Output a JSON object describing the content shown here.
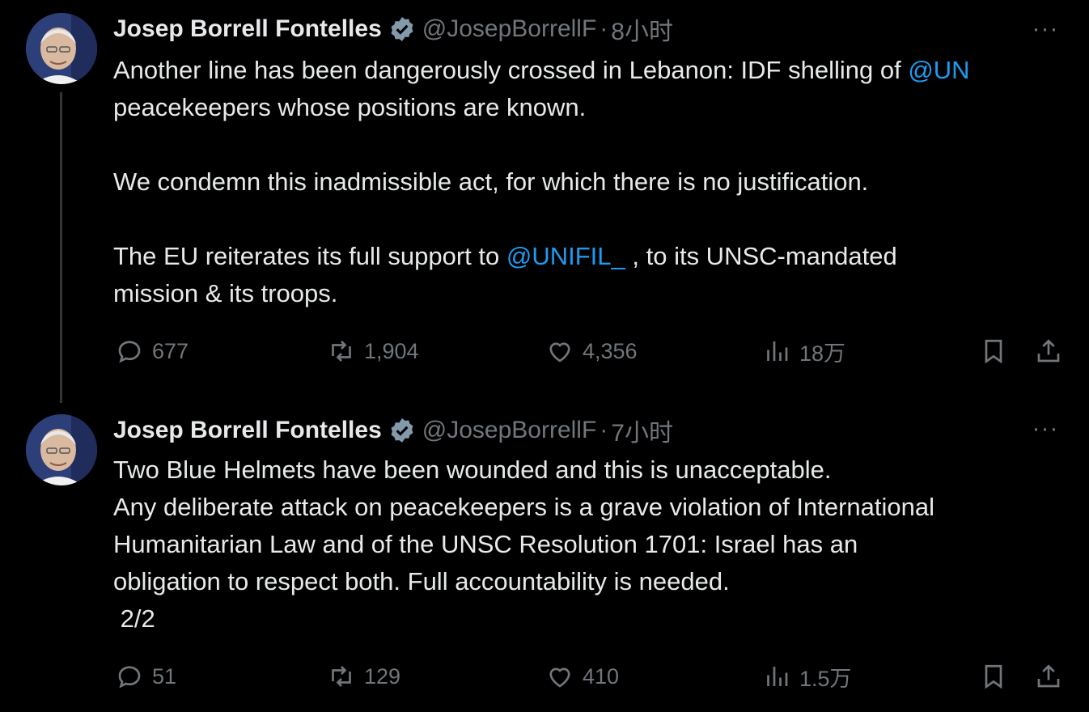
{
  "tweets": [
    {
      "author_name": "Josep Borrell Fontelles",
      "handle": "@JosepBorrellF",
      "separator": "·",
      "time": "8小时",
      "text_a": "Another line has been dangerously crossed in Lebanon: IDF shelling of ",
      "mention_un": "@UN",
      "text_b": "peacekeepers whose positions are known.",
      "text_c": "We condemn this inadmissible act, for which there is no justification.",
      "text_d1": "The EU reiterates its full support to ",
      "mention_unifil": "@UNIFIL_",
      "text_d2": " , to its UNSC-mandated",
      "text_e": "mission & its troops.",
      "replies": "677",
      "reposts": "1,904",
      "likes": "4,356",
      "views": "18万",
      "more": "···"
    },
    {
      "author_name": "Josep Borrell Fontelles",
      "handle": "@JosepBorrellF",
      "separator": "·",
      "time": "7小时",
      "lines": [
        "Two Blue Helmets have been wounded and this is unacceptable.",
        "Any deliberate attack on peacekeepers is a grave violation of International",
        "Humanitarian Law and of the UNSC Resolution 1701: Israel has an",
        "obligation to respect both. Full accountability is needed.",
        " 2/2"
      ],
      "replies": "51",
      "reposts": "129",
      "likes": "410",
      "views": "1.5万",
      "more": "···"
    }
  ],
  "icons": {
    "reply": "reply-icon",
    "repost": "repost-icon",
    "like": "heart-icon",
    "views": "views-icon",
    "bookmark": "bookmark-icon",
    "share": "share-icon",
    "verified": "verified-badge-icon",
    "more": "more-options-icon"
  },
  "colors": {
    "background": "#000000",
    "text": "#e7e9ea",
    "muted": "#71767b",
    "mention": "#1d9bf0",
    "verified_badge": "#829aab"
  }
}
